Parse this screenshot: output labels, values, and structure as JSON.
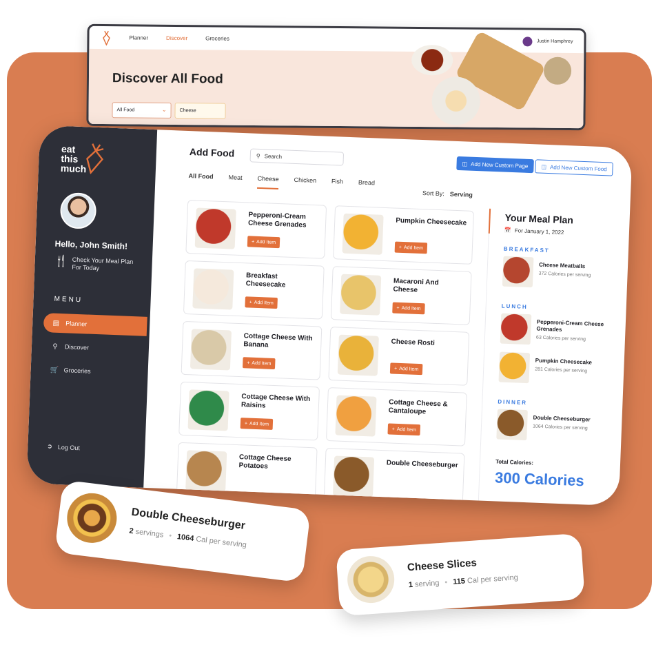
{
  "top_window": {
    "nav": [
      "Planner",
      "Discover",
      "Groceries"
    ],
    "active_nav": "Discover",
    "user_name": "Justin Hamphrey",
    "title": "Discover All Food",
    "filter_value": "All Food",
    "search_value": "Cheese"
  },
  "sidebar": {
    "logo_line1": "eat",
    "logo_line2": "this",
    "logo_line3": "much",
    "greeting": "Hello, John Smith!",
    "check_line1": "Check Your  Meal Plan",
    "check_line2": "For Today",
    "menu_heading": "MENU",
    "items": [
      {
        "label": "Planner",
        "icon": "planner-icon"
      },
      {
        "label": "Discover",
        "icon": "search-icon"
      },
      {
        "label": "Groceries",
        "icon": "cart-icon"
      }
    ],
    "logout": "Log Out"
  },
  "main": {
    "title": "Add Food",
    "search_placeholder": "Search",
    "btn_custom_page": "Add New Custom Page",
    "btn_custom_food": "Add New Custom Food",
    "tabs": [
      "All Food",
      "Meat",
      "Cheese",
      "Chicken",
      "Fish",
      "Bread"
    ],
    "sort_label": "Sort By:",
    "sort_value": "Serving",
    "add_label": "Add Item",
    "cards": [
      {
        "name": "Pepperoni-Cream Cheese Grenades",
        "color": "#c0392b"
      },
      {
        "name": "Pumpkin Cheesecake",
        "color": "#f2b233"
      },
      {
        "name": "Breakfast Cheesecake",
        "color": "#f5e9dc"
      },
      {
        "name": "Macaroni And Cheese",
        "color": "#e8c46a"
      },
      {
        "name": "Cottage Cheese With Banana",
        "color": "#d9c9a8"
      },
      {
        "name": "Cheese Rosti",
        "color": "#e9b23a"
      },
      {
        "name": "Cottage Cheese With Raisins",
        "color": "#2f8a4a"
      },
      {
        "name": "Cottage Cheese & Cantaloupe",
        "color": "#f0a040"
      },
      {
        "name": "Cottage Cheese Potatoes",
        "color": "#b7864f"
      },
      {
        "name": "Double Cheeseburger",
        "color": "#8a5a2a"
      }
    ]
  },
  "meal_plan": {
    "title": "Your Meal Plan",
    "date": "For January 1, 2022",
    "sections": [
      {
        "label": "BREAKFAST",
        "items": [
          {
            "name": "Cheese Meatballs",
            "cal": "372 Calories per serving",
            "color": "#b5462f"
          }
        ]
      },
      {
        "label": "LUNCH",
        "items": [
          {
            "name": "Pepperoni-Cream Cheese Grenades",
            "cal": "63 Calories per serving",
            "color": "#c0392b"
          },
          {
            "name": "Pumpkin Cheesecake",
            "cal": "281 Calories per serving",
            "color": "#f2b233"
          }
        ]
      },
      {
        "label": "DINNER",
        "items": [
          {
            "name": "Double Cheeseburger",
            "cal": "1064 Calories per serving",
            "color": "#8a5a2a"
          }
        ]
      }
    ],
    "total_label": "Total Calories:",
    "total_value": "300 Calories"
  },
  "float_burger": {
    "title": "Double Cheeseburger",
    "servings_num": "2",
    "servings_word": "servings",
    "cal_num": "1064",
    "cal_word": "Cal per serving"
  },
  "float_cheese": {
    "title": "Cheese Slices",
    "servings_num": "1",
    "servings_word": "serving",
    "cal_num": "115",
    "cal_word": "Cal per serving"
  },
  "colors": {
    "accent": "#e2703a",
    "blue": "#3a7be0",
    "sidebar": "#2d2f38",
    "background": "#d97d51"
  }
}
